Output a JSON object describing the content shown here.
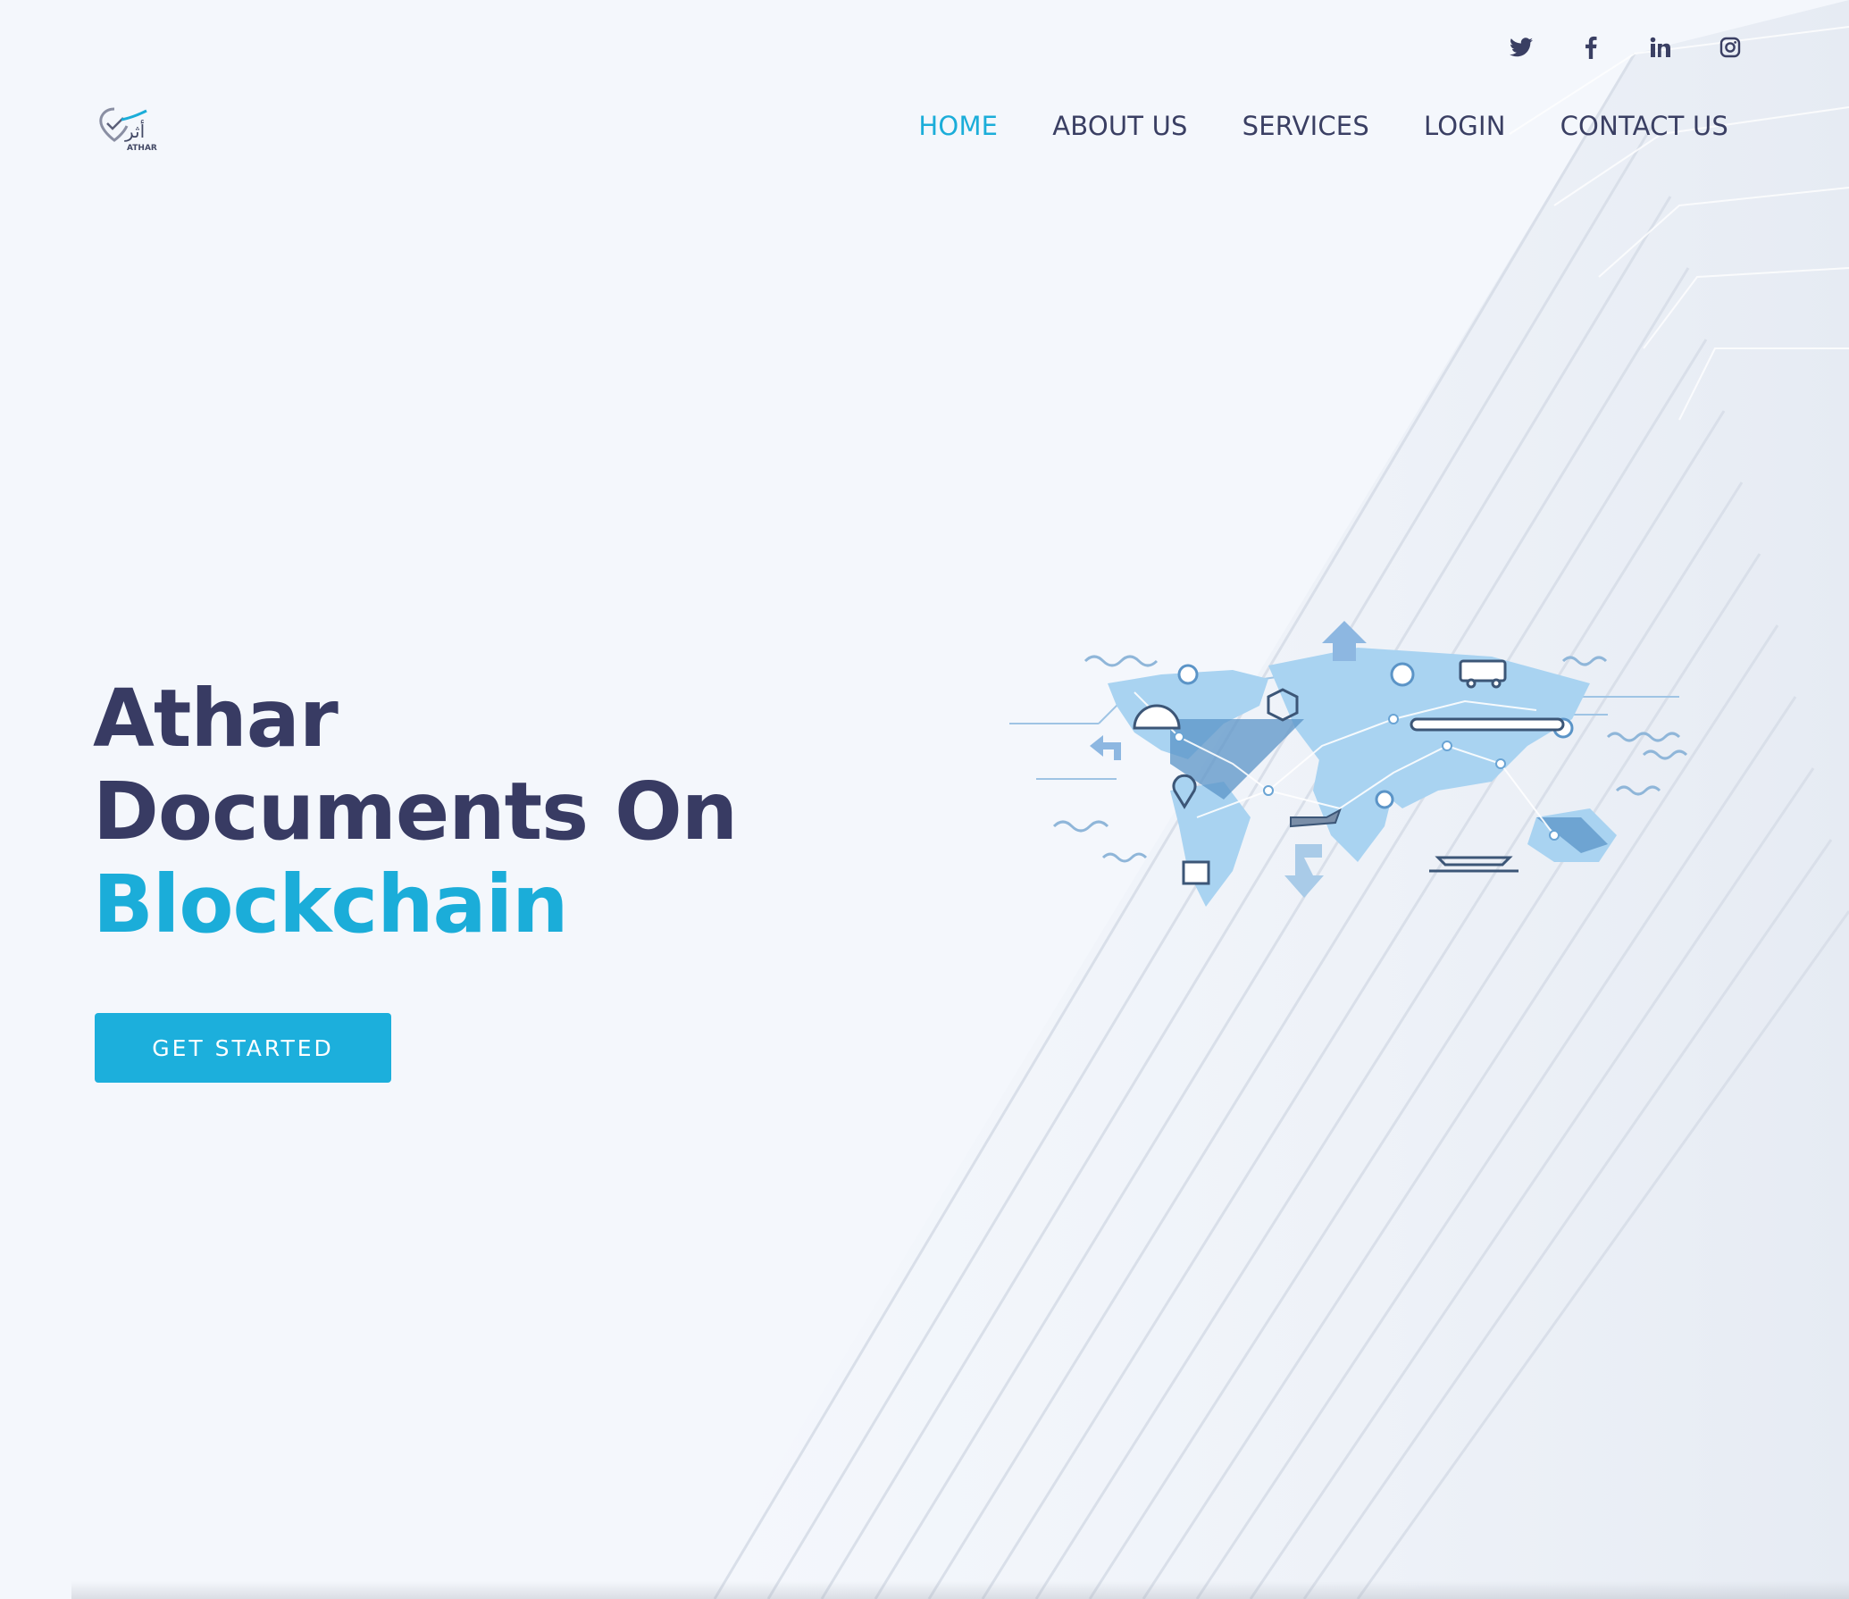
{
  "brand": {
    "logo_name": "ATHAR",
    "logo_arabic": "أثر"
  },
  "social": [
    {
      "name": "twitter",
      "icon": "twitter-icon"
    },
    {
      "name": "facebook",
      "icon": "facebook-icon"
    },
    {
      "name": "linkedin",
      "icon": "linkedin-icon"
    },
    {
      "name": "instagram",
      "icon": "instagram-icon"
    }
  ],
  "nav": {
    "home": "HOME",
    "about": "ABOUT US",
    "services": "SERVICES",
    "login": "LOGIN",
    "contact": "CONTACT US"
  },
  "hero": {
    "line1": "Athar",
    "line2": "Documents On",
    "line3": "Blockchain",
    "cta": "GET STARTED"
  },
  "colors": {
    "accent": "#1badd9",
    "text": "#383b63",
    "background": "#f4f7fc"
  }
}
